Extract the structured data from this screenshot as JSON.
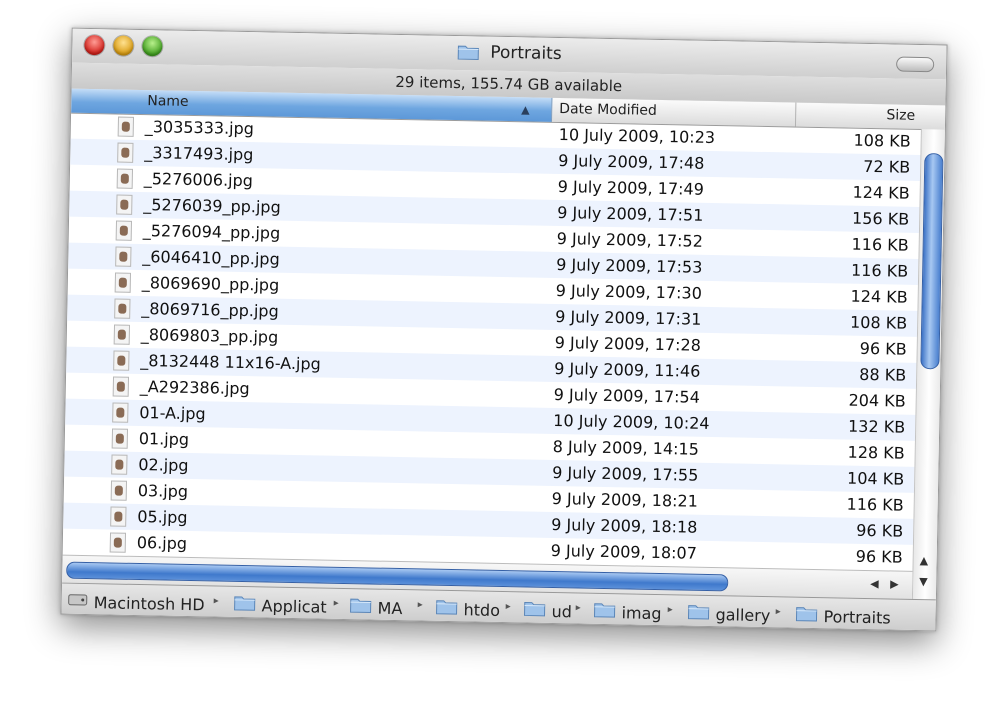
{
  "window": {
    "title": "Portraits",
    "status": "29 items, 155.74 GB available"
  },
  "columns": {
    "name": "Name",
    "date": "Date Modified",
    "size": "Size"
  },
  "files": [
    {
      "name": "_3035333.jpg",
      "date": "10 July 2009, 10:23",
      "size": "108 KB"
    },
    {
      "name": "_3317493.jpg",
      "date": "9 July 2009, 17:48",
      "size": "72 KB"
    },
    {
      "name": "_5276006.jpg",
      "date": "9 July 2009, 17:49",
      "size": "124 KB"
    },
    {
      "name": "_5276039_pp.jpg",
      "date": "9 July 2009, 17:51",
      "size": "156 KB"
    },
    {
      "name": "_5276094_pp.jpg",
      "date": "9 July 2009, 17:52",
      "size": "116 KB"
    },
    {
      "name": "_6046410_pp.jpg",
      "date": "9 July 2009, 17:53",
      "size": "116 KB"
    },
    {
      "name": "_8069690_pp.jpg",
      "date": "9 July 2009, 17:30",
      "size": "124 KB"
    },
    {
      "name": "_8069716_pp.jpg",
      "date": "9 July 2009, 17:31",
      "size": "108 KB"
    },
    {
      "name": "_8069803_pp.jpg",
      "date": "9 July 2009, 17:28",
      "size": "96 KB"
    },
    {
      "name": "_8132448 11x16-A.jpg",
      "date": "9 July 2009, 11:46",
      "size": "88 KB"
    },
    {
      "name": "_A292386.jpg",
      "date": "9 July 2009, 17:54",
      "size": "204 KB"
    },
    {
      "name": "01-A.jpg",
      "date": "10 July 2009, 10:24",
      "size": "132 KB"
    },
    {
      "name": "01.jpg",
      "date": "8 July 2009, 14:15",
      "size": "128 KB"
    },
    {
      "name": "02.jpg",
      "date": "9 July 2009, 17:55",
      "size": "104 KB"
    },
    {
      "name": "03.jpg",
      "date": "9 July 2009, 18:21",
      "size": "116 KB"
    },
    {
      "name": "05.jpg",
      "date": "9 July 2009, 18:18",
      "size": "96 KB"
    },
    {
      "name": "06.jpg",
      "date": "9 July 2009, 18:07",
      "size": "96 KB"
    }
  ],
  "path": [
    {
      "label": "Macintosh HD",
      "icon": "hard-drive-icon"
    },
    {
      "label": "Applicat",
      "icon": "applications-folder-icon"
    },
    {
      "label": "MA",
      "icon": "folder-icon"
    },
    {
      "label": "htdo",
      "icon": "folder-icon"
    },
    {
      "label": "ud",
      "icon": "folder-icon"
    },
    {
      "label": "imag",
      "icon": "folder-icon"
    },
    {
      "label": "gallery",
      "icon": "folder-icon"
    },
    {
      "label": "Portraits",
      "icon": "folder-icon"
    }
  ]
}
